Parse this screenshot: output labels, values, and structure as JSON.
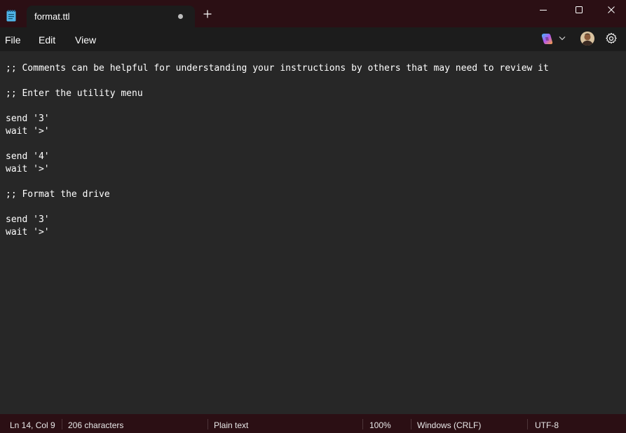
{
  "window": {
    "tab_title": "format.ttl",
    "new_tab_glyph": "+",
    "icons": [
      "notepad-icon",
      "unsaved-dot-icon",
      "plus-icon",
      "minimize-icon",
      "maximize-icon",
      "close-icon"
    ]
  },
  "menu": {
    "items": [
      "File",
      "Edit",
      "View"
    ],
    "right_icons": [
      "copilot-icon",
      "chevron-down-icon",
      "avatar",
      "gear-icon"
    ]
  },
  "editor": {
    "lines": [
      ";; Comments can be helpful for understanding your instructions by others that may need to review it",
      "",
      ";; Enter the utility menu",
      "",
      "send '3'",
      "wait '>'",
      "",
      "send '4'",
      "wait '>'",
      "",
      ";; Format the drive",
      "",
      "send '3'",
      "wait '>'"
    ]
  },
  "status": {
    "position": "Ln 14, Col 9",
    "characters": "206 characters",
    "syntax": "Plain text",
    "zoom": "100%",
    "line_ending": "Windows (CRLF)",
    "encoding": "UTF-8"
  },
  "colors": {
    "titlebar_bg": "#2b0f14",
    "tab_bg": "#1c1c1c",
    "editor_bg": "#272727",
    "text": "#ffffff"
  }
}
